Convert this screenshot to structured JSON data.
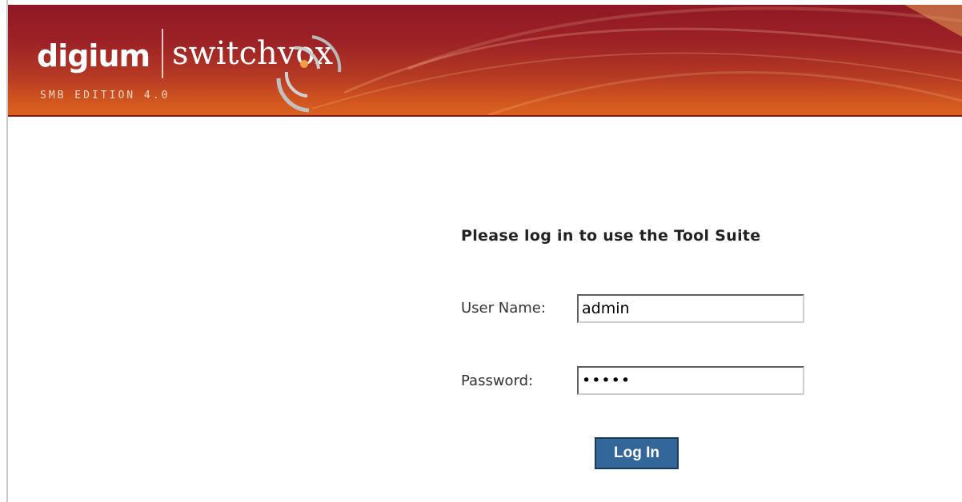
{
  "header": {
    "brand_left": "digium",
    "brand_right": "switchvox",
    "edition": "SMB EDITION 4.0",
    "colors": {
      "top": "#8f1824",
      "bottom": "#dc6220"
    }
  },
  "login": {
    "title": "Please log in to use the Tool Suite",
    "username_label": "User Name:",
    "username_value": "admin",
    "password_label": "Password:",
    "password_value": "•••••",
    "submit_label": "Log In",
    "button_color": "#336699"
  }
}
